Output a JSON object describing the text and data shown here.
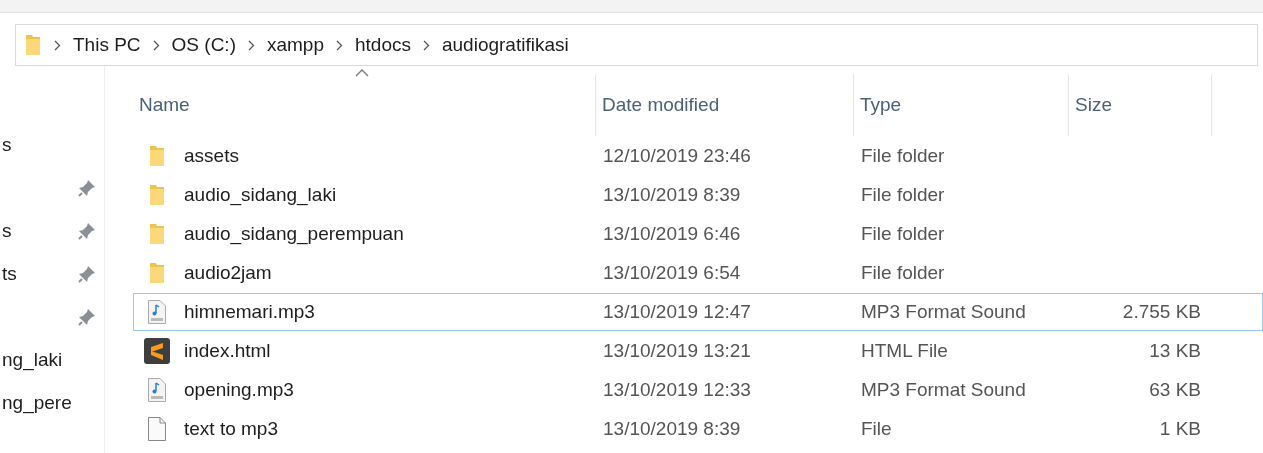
{
  "address_bar": {
    "crumbs": [
      "This PC",
      "OS (C:)",
      "xampp",
      "htdocs",
      "audiogratifikasi"
    ]
  },
  "sidebar": {
    "items": [
      {
        "label": "s",
        "pinned": false
      },
      {
        "pinned": true
      },
      {
        "label": "s",
        "pinned": true
      },
      {
        "label": "ts",
        "pinned": true
      },
      {
        "pinned": true
      },
      {
        "label": "ng_laki",
        "pinned": false
      },
      {
        "label": "ng_pere",
        "pinned": false
      }
    ]
  },
  "table": {
    "columns": [
      {
        "label": "Name",
        "sorted": true
      },
      {
        "label": "Date modified",
        "sorted": false
      },
      {
        "label": "Type",
        "sorted": false
      },
      {
        "label": "Size",
        "sorted": false
      }
    ],
    "rows": [
      {
        "kind": "folder",
        "name": "assets",
        "date": "12/10/2019 23:46",
        "type": "File folder",
        "focused": false
      },
      {
        "kind": "folder",
        "name": "audio_sidang_laki",
        "date": "13/10/2019 8:39",
        "type": "File folder",
        "focused": false
      },
      {
        "kind": "folder",
        "name": "audio_sidang_perempuan",
        "date": "13/10/2019 6:46",
        "type": "File folder",
        "focused": false
      },
      {
        "kind": "folder",
        "name": "audio2jam",
        "date": "13/10/2019 6:54",
        "type": "File folder",
        "focused": false
      },
      {
        "kind": "audio",
        "name": "himnemari.mp3",
        "date": "13/10/2019 12:47",
        "type": "MP3 Format Sound",
        "size": "2.755 KB",
        "focused": true
      },
      {
        "kind": "html",
        "name": "index.html",
        "date": "13/10/2019 13:21",
        "type": "HTML File",
        "size": "13 KB",
        "focused": false
      },
      {
        "kind": "audio",
        "name": "opening.mp3",
        "date": "13/10/2019 12:33",
        "type": "MP3 Format Sound",
        "size": "63 KB",
        "focused": false
      },
      {
        "kind": "file",
        "name": "text to mp3",
        "date": "13/10/2019 8:39",
        "type": "File",
        "size": "1 KB",
        "focused": false
      }
    ]
  }
}
